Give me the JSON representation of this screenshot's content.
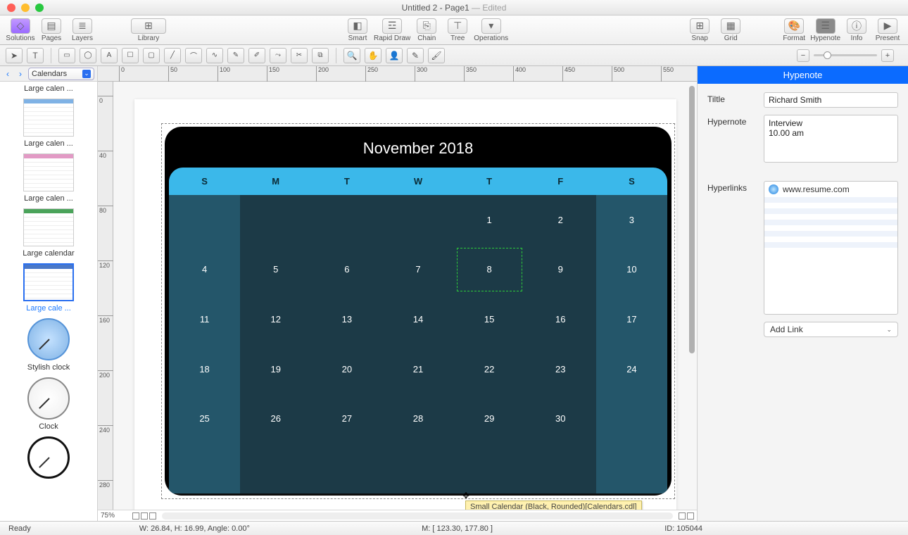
{
  "titlebar": {
    "doc": "Untitled 2 - Page1",
    "suffix": "Edited"
  },
  "toolbar": [
    {
      "label": "Solutions",
      "icon": "◇"
    },
    {
      "label": "Pages",
      "icon": "▤"
    },
    {
      "label": "Layers",
      "icon": "≣"
    },
    {
      "label": "Library",
      "icon": "⊞",
      "wide": true
    },
    {
      "label": "Smart",
      "icon": "◧"
    },
    {
      "label": "Rapid Draw",
      "icon": "☲"
    },
    {
      "label": "Chain",
      "icon": "⎘"
    },
    {
      "label": "Tree",
      "icon": "⊤"
    },
    {
      "label": "Operations",
      "icon": "▾"
    },
    {
      "label": "Snap",
      "icon": "⊞"
    },
    {
      "label": "Grid",
      "icon": "▦"
    },
    {
      "label": "Format",
      "icon": "🎨"
    },
    {
      "label": "Hypenote",
      "icon": "☰",
      "selected": true
    },
    {
      "label": "Info",
      "icon": "ⓘ"
    },
    {
      "label": "Present",
      "icon": "▶"
    }
  ],
  "library": {
    "title": "Calendars",
    "items": [
      {
        "label": "Large calen ...",
        "kind": "img"
      },
      {
        "label": "Large calen ...",
        "kind": "blue-grid"
      },
      {
        "label": "Large calen ...",
        "kind": "pink-grid"
      },
      {
        "label": "Large calendar",
        "kind": "green-grid"
      },
      {
        "label": "Large cale ...",
        "kind": "blue-grid",
        "selected": true
      },
      {
        "label": "Stylish clock",
        "kind": "clock-blue"
      },
      {
        "label": "Clock",
        "kind": "clock"
      },
      {
        "label": "",
        "kind": "clock-black"
      }
    ]
  },
  "calendar": {
    "title": "November 2018",
    "days": [
      "S",
      "M",
      "T",
      "W",
      "T",
      "F",
      "S"
    ],
    "weeks": [
      [
        "",
        "",
        "",
        "",
        "1",
        "2",
        "3"
      ],
      [
        "4",
        "5",
        "6",
        "7",
        "8",
        "9",
        "10"
      ],
      [
        "11",
        "12",
        "13",
        "14",
        "15",
        "16",
        "17"
      ],
      [
        "18",
        "19",
        "20",
        "21",
        "22",
        "23",
        "24"
      ],
      [
        "25",
        "26",
        "27",
        "28",
        "29",
        "30",
        ""
      ],
      [
        "",
        "",
        "",
        "",
        "",
        "",
        ""
      ]
    ],
    "selected_day": "8"
  },
  "tooltip": "Small Calendar (Black, Rounded)[Calendars.cdl]",
  "rightpanel": {
    "header": "Hypenote",
    "fields": {
      "title_label": "Tiltle",
      "title_value": "Richard Smith",
      "hypernote_label": "Hypernote",
      "hypernote_value": "Interview\n10.00 am",
      "hyperlinks_label": "Hyperlinks",
      "link": "www.resume.com",
      "addlink": "Add Link"
    }
  },
  "zoom": "75%",
  "status": {
    "ready": "Ready",
    "dims": "W: 26.84,  H: 16.99,  Angle: 0.00°",
    "mouse": "M: [ 123.30, 177.80 ]",
    "id": "ID: 105044"
  },
  "ruler_ticks_h": [
    0,
    50,
    100,
    150,
    200,
    250,
    300,
    350,
    400,
    450,
    500,
    550
  ],
  "ruler_ticks_v": [
    0,
    40,
    80,
    120,
    160,
    200,
    240,
    280
  ]
}
